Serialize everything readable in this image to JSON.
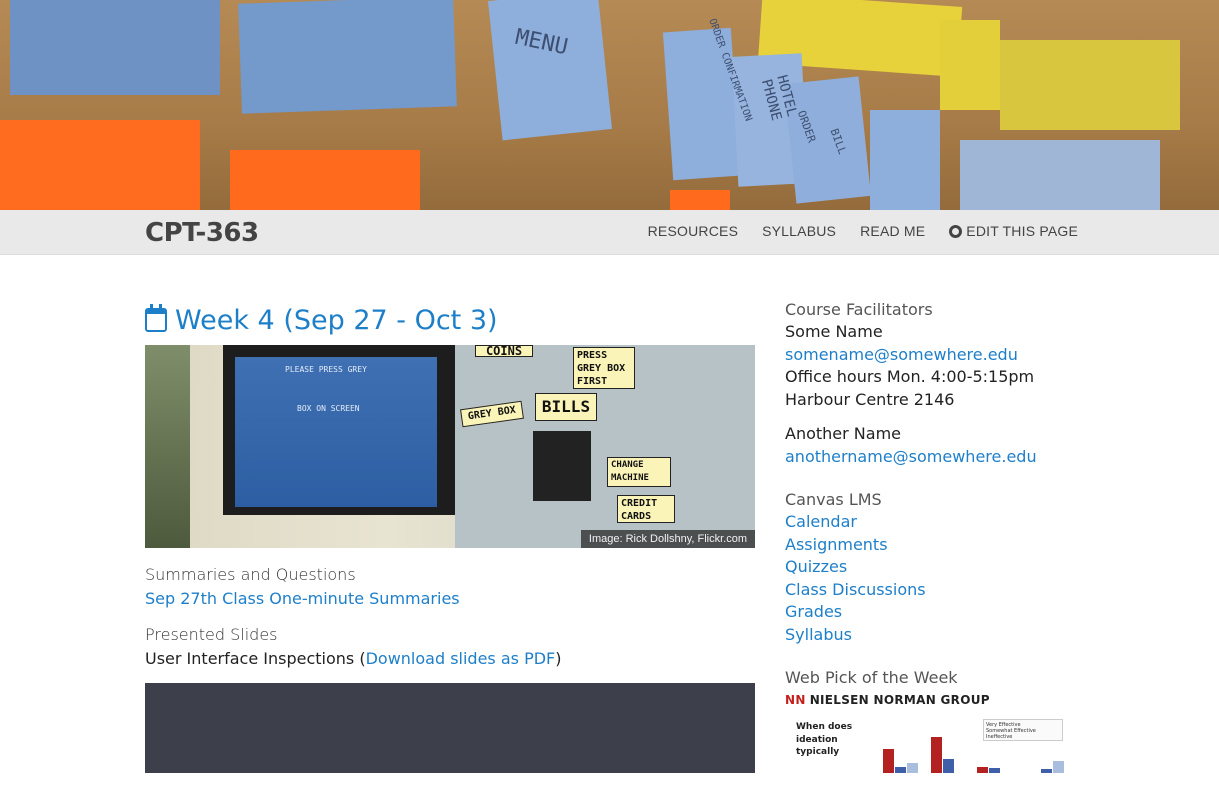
{
  "hero": {
    "scribbles": [
      "MENU",
      "ORDER CONFIRMATION",
      "HOTEL PHONE",
      "ORDER",
      "BILL"
    ]
  },
  "navbar": {
    "brand": "CPT-363",
    "links": [
      "RESOURCES",
      "SYLLABUS",
      "READ ME",
      "EDIT THIS PAGE"
    ]
  },
  "main": {
    "week_title": "Week 4 (Sep 27 - Oct 3)",
    "image": {
      "credit": "Image: Rick Dollshny, Flickr.com",
      "screen_text_1": "PLEASE PRESS GREY",
      "screen_text_2": "BOX ON SCREEN",
      "label_coins": "COINS",
      "label_press": "PRESS GREY BOX FIRST",
      "label_grey_box": "GREY BOX",
      "label_bills": "BILLS",
      "label_change": "CHANGE MACHINE",
      "label_credit": "CREDIT CARDS"
    },
    "summaries_heading": "Summaries and Questions",
    "summaries_link": "Sep 27th Class One-minute Summaries",
    "slides_heading": "Presented Slides",
    "slides_text": "User Interface Inspections (",
    "slides_link": "Download slides as PDF",
    "slides_close": ")"
  },
  "sidebar": {
    "facilitators_heading": "Course Facilitators",
    "person1": {
      "name": "Some Name",
      "email": "somename@somewhere.edu",
      "hours": "Office hours Mon. 4:00-5:15pm",
      "room": "Harbour Centre 2146"
    },
    "person2": {
      "name": "Another Name",
      "email": "anothername@somewhere.edu"
    },
    "lms_heading": "Canvas LMS",
    "lms_links": [
      "Calendar",
      "Assignments",
      "Quizzes",
      "Class Discussions",
      "Grades",
      "Syllabus"
    ],
    "pick_heading": "Web Pick of the Week",
    "pick": {
      "logo_mark": "NN",
      "logo_text": "NIELSEN NORMAN GROUP",
      "question": "When does ideation typically",
      "legend": [
        "Very Effective",
        "Somewhat Effective",
        "Ineffective"
      ]
    }
  },
  "colors": {
    "link": "#1e7fc9",
    "navbar_bg": "#e9e9e9",
    "brand": "#444444",
    "video_bg": "#3d3f4b"
  }
}
